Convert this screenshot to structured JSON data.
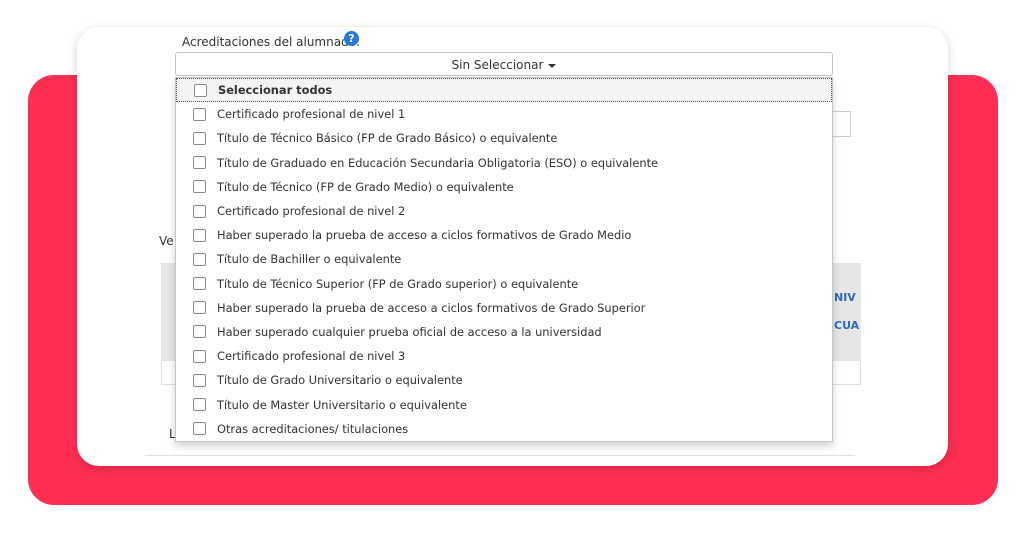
{
  "field": {
    "label": "Acreditaciones del alumnado:",
    "help_icon": "question-circle-icon",
    "button_label": "Sin Seleccionar"
  },
  "background": {
    "ve_text": "Ve",
    "niv_text": "NIV",
    "cua_text": "CUA",
    "l_text": "L"
  },
  "dropdown": {
    "select_all": "Seleccionar todos",
    "options": [
      "Certificado profesional de nivel 1",
      "Título de Técnico Básico (FP de Grado Básico) o equivalente",
      "Título de Graduado en Educación Secundaria Obligatoria (ESO) o equivalente",
      "Título de Técnico (FP de Grado Medio) o equivalente",
      "Certificado profesional de nivel 2",
      "Haber superado la prueba de acceso a ciclos formativos de Grado Medio",
      "Título de Bachiller o equivalente",
      "Título de Técnico Superior (FP de Grado superior) o equivalente",
      "Haber superado la prueba de acceso a ciclos formativos de Grado Superior",
      "Haber superado cualquier prueba oficial de acceso a la universidad",
      "Certificado profesional de nivel 3",
      "Título de Grado Universitario o equivalente",
      "Título de Master Universitario o equivalente",
      "Otras acreditaciones/ titulaciones"
    ]
  },
  "colors": {
    "accent_red": "#ff2f53",
    "help_blue": "#2878d6",
    "link_blue": "#2a6db4"
  }
}
